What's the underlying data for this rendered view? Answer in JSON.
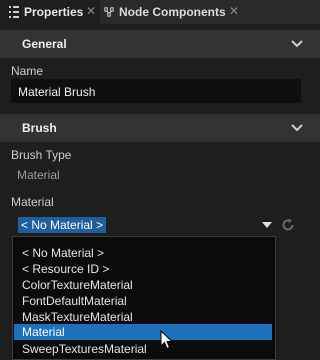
{
  "tabs": [
    {
      "label": "Properties",
      "icon": "properties-icon",
      "active": true
    },
    {
      "label": "Node Components",
      "icon": "node-components-icon",
      "active": false
    }
  ],
  "sections": {
    "general": {
      "title": "General"
    },
    "brush": {
      "title": "Brush"
    }
  },
  "fields": {
    "name": {
      "label": "Name",
      "value": "Material Brush"
    },
    "brush_type": {
      "label": "Brush Type",
      "value": "Material"
    },
    "material": {
      "label": "Material",
      "selected": "< No Material >"
    }
  },
  "dropdown": {
    "options": [
      "< No Material >",
      "< Resource ID >",
      "ColorTextureMaterial",
      "FontDefaultMaterial",
      "MaskTextureMaterial",
      "Material",
      "SweepTexturesMaterial"
    ],
    "highlighted_index": 5
  },
  "colors": {
    "background": "#1e1e1e",
    "section_header": "#333333",
    "selection": "#1f6fbf",
    "field": "#0f0f0f"
  }
}
